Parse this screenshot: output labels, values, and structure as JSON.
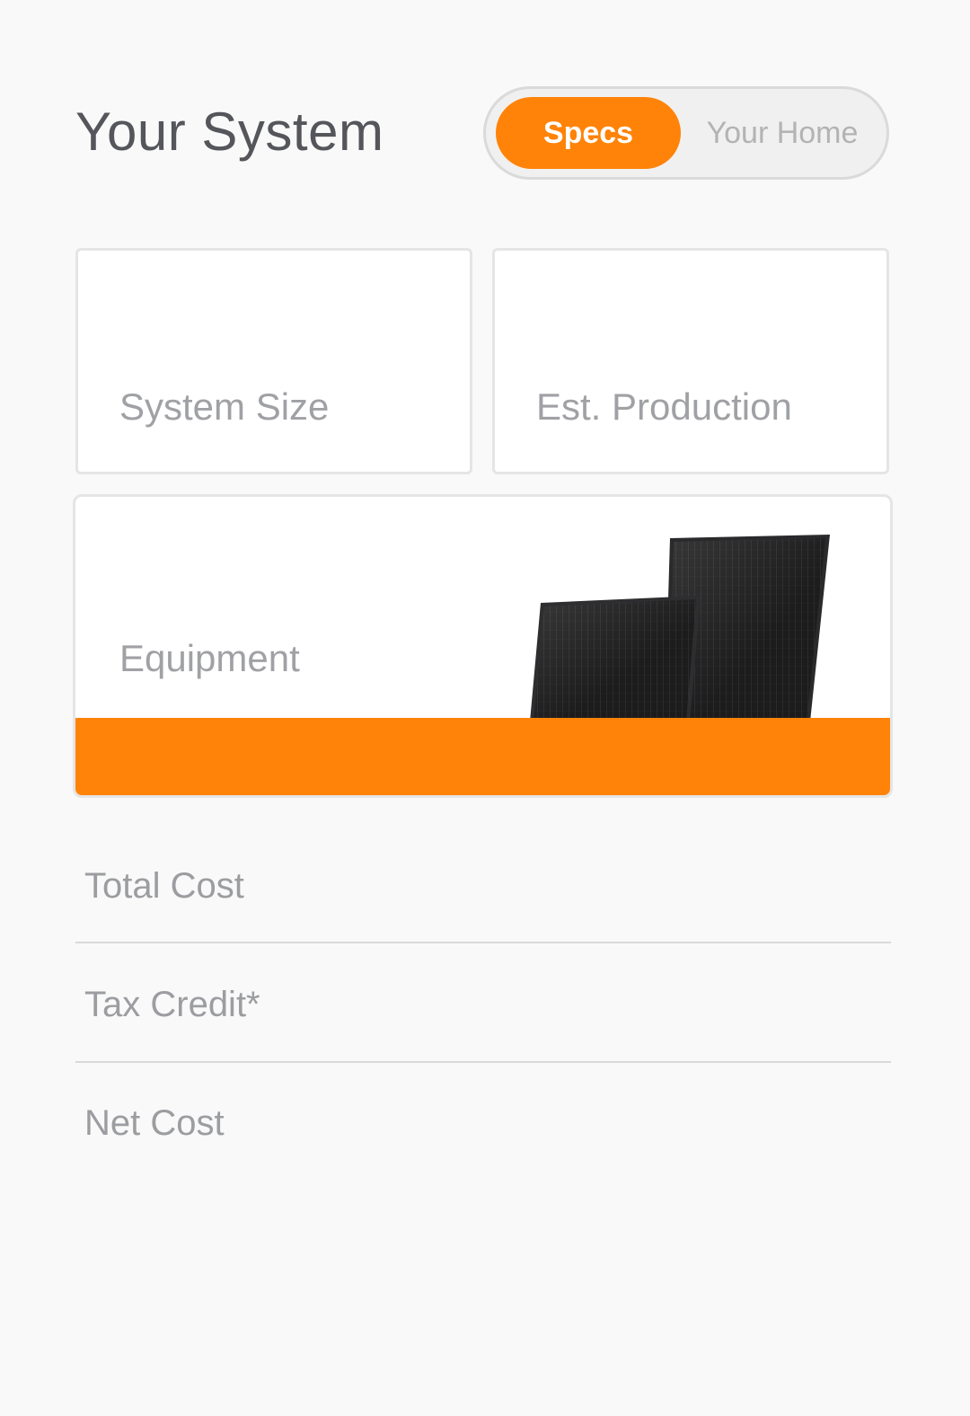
{
  "header": {
    "title": "Your System"
  },
  "toggle": {
    "options": [
      {
        "label": "Specs",
        "active": true
      },
      {
        "label": "Your Home",
        "active": false
      }
    ]
  },
  "cards": {
    "system_size": {
      "label": "System Size"
    },
    "production": {
      "label": "Est. Production"
    },
    "equipment": {
      "label": "Equipment"
    }
  },
  "costs": {
    "rows": [
      {
        "label": "Total Cost"
      },
      {
        "label": "Tax Credit*"
      },
      {
        "label": "Net Cost"
      }
    ]
  },
  "colors": {
    "accent": "#ff8308",
    "background": "#f9f9f9",
    "title_text": "#55565b",
    "muted_text": "#a0a1a4"
  },
  "icons": {
    "equipment_image": "solar-panels-image"
  }
}
